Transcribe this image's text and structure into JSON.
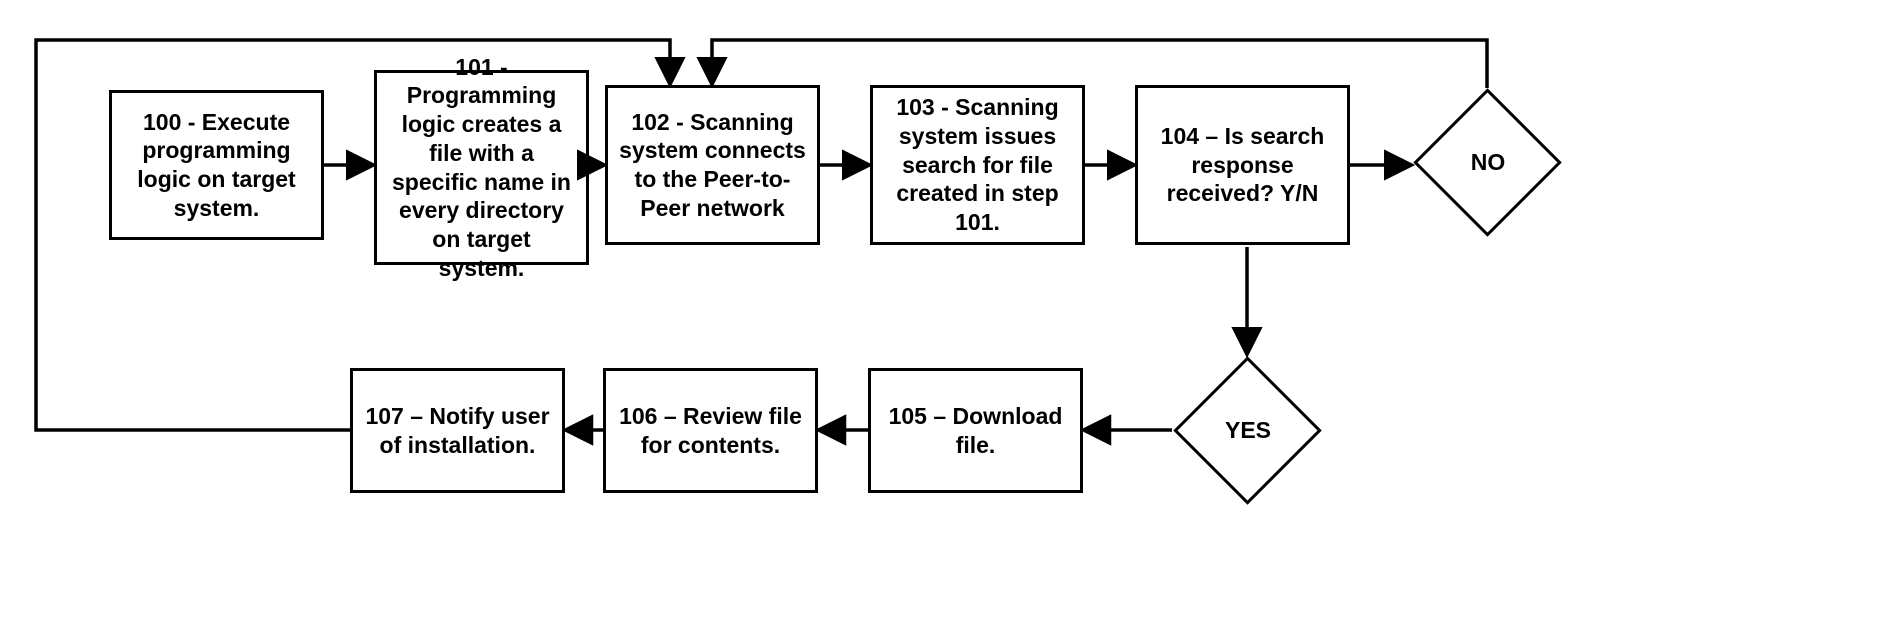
{
  "flow": {
    "steps": {
      "s100": "100 - Execute programming logic on target system.",
      "s101": "101 - Programming logic creates a file with a specific name in every directory on target system.",
      "s102": "102 - Scanning system connects to the Peer-to-Peer network",
      "s103": "103 - Scanning system issues search for file created in step 101.",
      "s104": "104 – Is search response received? Y/N",
      "s105": "105 – Download file.",
      "s106": "106 – Review file for contents.",
      "s107": "107 – Notify user of installation."
    },
    "branches": {
      "no": "NO",
      "yes": "YES"
    }
  }
}
